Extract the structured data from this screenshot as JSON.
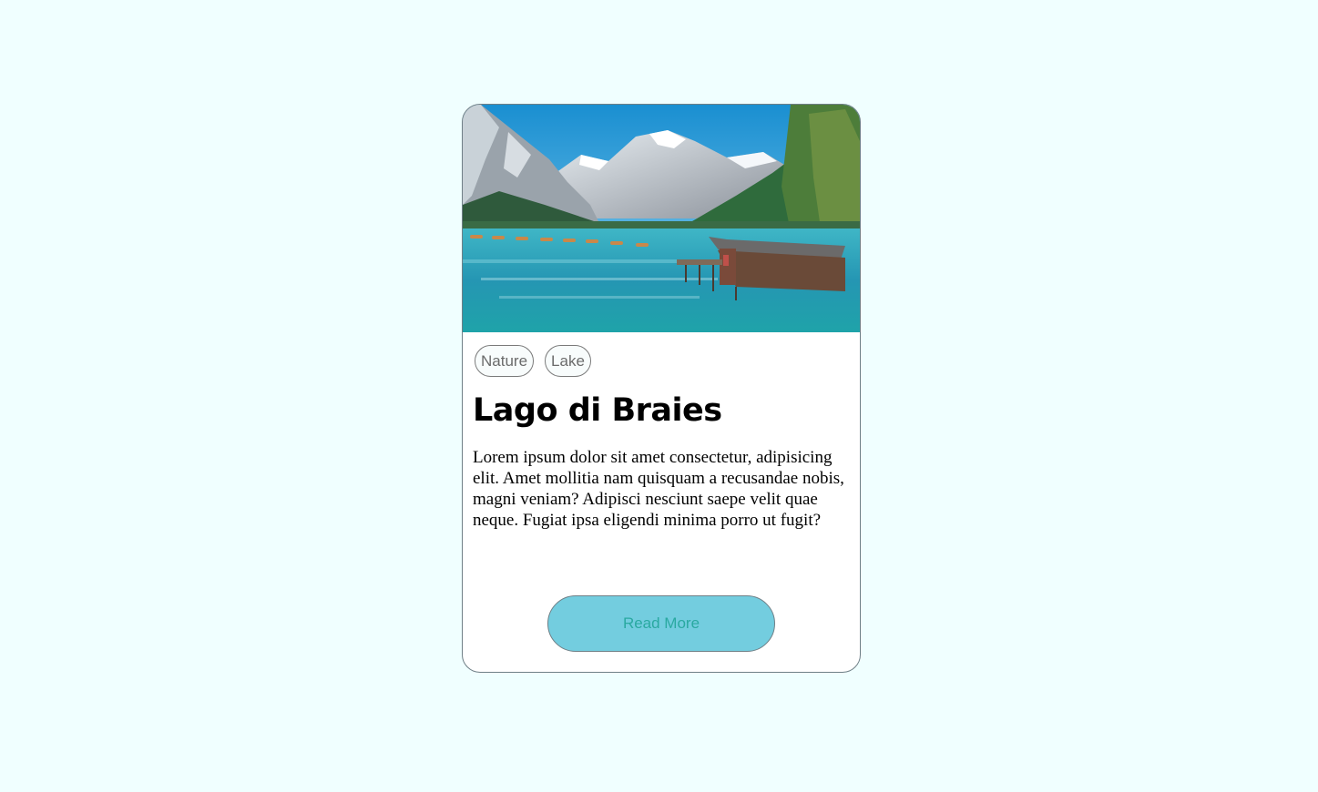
{
  "card": {
    "image": {
      "alt": "Lago di Braies",
      "icon": "landscape-photo"
    },
    "tags": [
      "Nature",
      "Lake"
    ],
    "title": "Lago di Braies",
    "description": "Lorem ipsum dolor sit amet consectetur, adipisicing elit. Amet mollitia nam quisquam a recusandae nobis, magni veniam? Adipisci nesciunt saepe velit quae neque. Fugiat ipsa eligendi minima porro ut fugit?",
    "button_label": "Read More"
  },
  "colors": {
    "page_background": "#f0ffff",
    "button_background": "#73cddf",
    "button_text": "#2aa9a1"
  }
}
